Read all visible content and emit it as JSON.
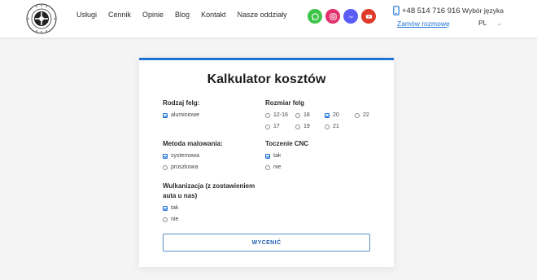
{
  "header": {
    "nav": [
      "Usługi",
      "Cennik",
      "Opinie",
      "Blog",
      "Kontakt",
      "Nasze oddziały"
    ],
    "phone": "+48 514 716 916",
    "callback_link": "Zamów rozmowę",
    "language_label": "Wybór języka",
    "language_value": "PL",
    "social": [
      {
        "name": "whatsapp-icon",
        "color": "#3fc44a"
      },
      {
        "name": "instagram-icon",
        "color": "#e1306c"
      },
      {
        "name": "messenger-icon",
        "color": "#5a5cf6"
      },
      {
        "name": "youtube-icon",
        "color": "#e03a2b"
      }
    ]
  },
  "calculator": {
    "title": "Kalkulator kosztów",
    "rim_type": {
      "label": "Rodzaj felg:",
      "options": [
        {
          "label": "aluminiowe",
          "checked": true
        }
      ]
    },
    "rim_size": {
      "label": "Rozmiar felg",
      "options": [
        {
          "label": "12-16",
          "checked": false
        },
        {
          "label": "18",
          "checked": false
        },
        {
          "label": "20",
          "checked": true
        },
        {
          "label": "22",
          "checked": false
        },
        {
          "label": "17",
          "checked": false
        },
        {
          "label": "19",
          "checked": false
        },
        {
          "label": "21",
          "checked": false
        }
      ]
    },
    "paint_method": {
      "label": "Metoda malowania:",
      "options": [
        {
          "label": "systemowa",
          "checked": true
        },
        {
          "label": "proszkowa",
          "checked": false
        }
      ]
    },
    "cnc": {
      "label": "Toczenie CNC",
      "options": [
        {
          "label": "tak",
          "checked": true
        },
        {
          "label": "nie",
          "checked": false
        }
      ]
    },
    "vulcanization": {
      "label_line1": "Wulkanizacja (z zostawieniem",
      "label_line2": "auta u nas)",
      "options": [
        {
          "label": "tak",
          "checked": true
        },
        {
          "label": "nie",
          "checked": false
        }
      ]
    },
    "submit_label": "WYCENIĆ"
  }
}
